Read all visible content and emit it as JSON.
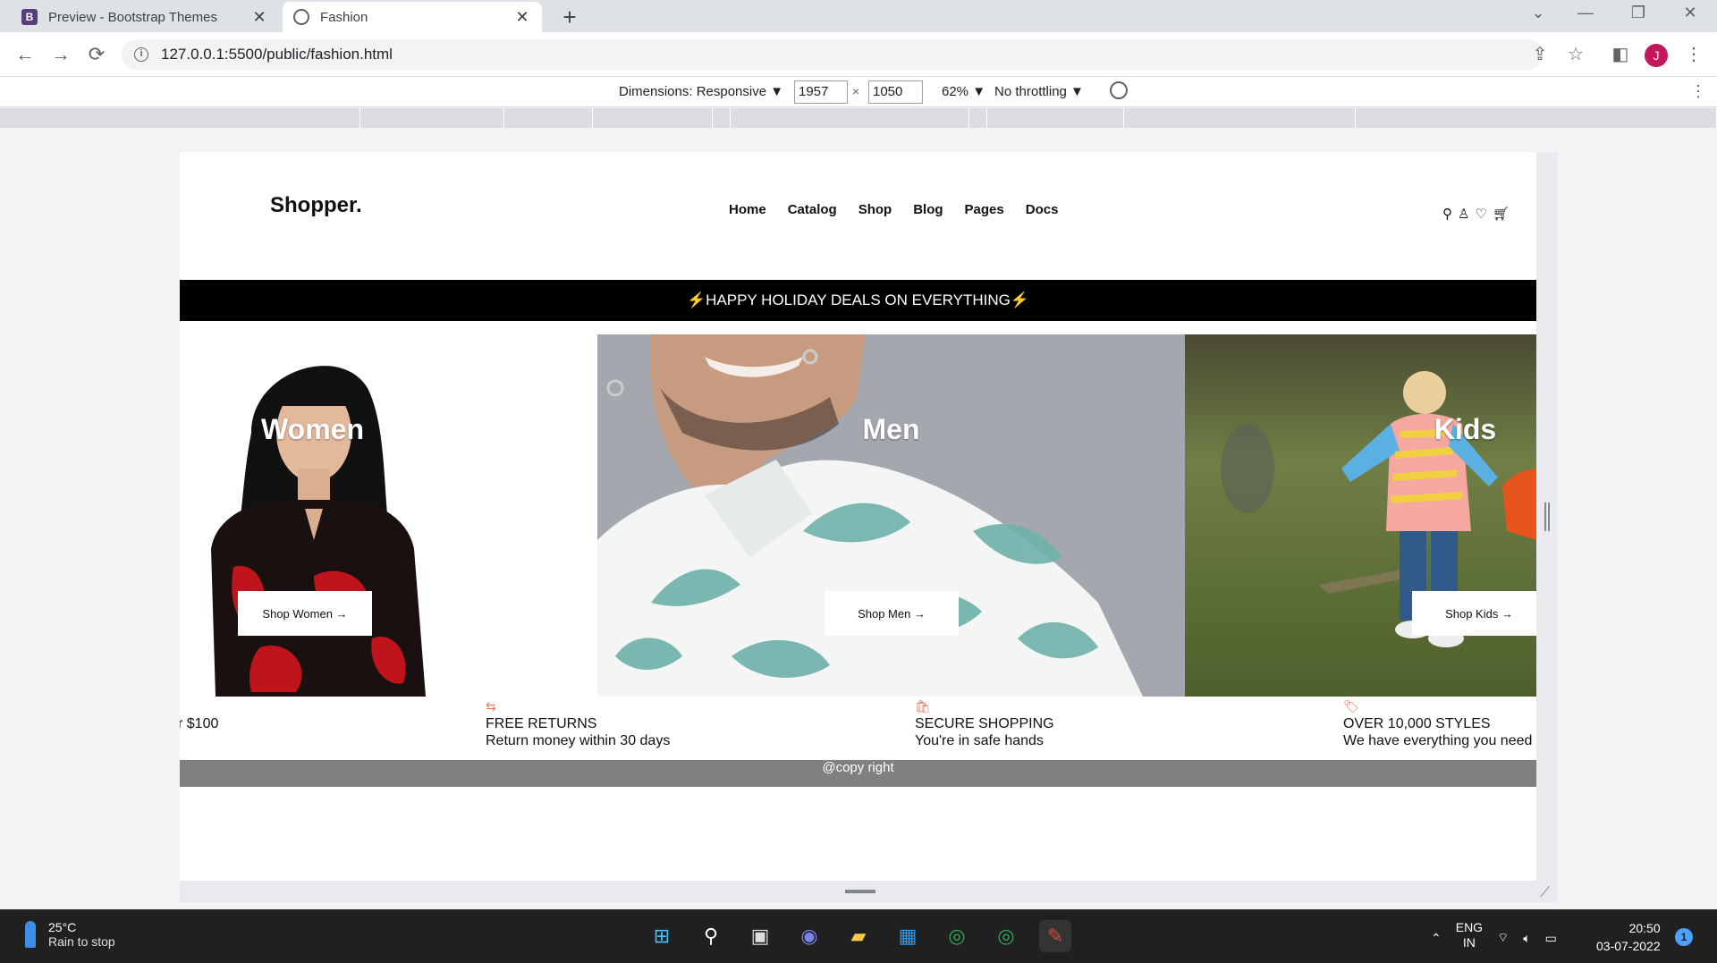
{
  "browser": {
    "tabs": [
      {
        "favicon": "B",
        "title": "Preview - Bootstrap Themes",
        "close": "✕"
      },
      {
        "favicon": "",
        "title": "Fashion",
        "close": "✕"
      }
    ],
    "new_tab": "+",
    "window_controls": {
      "minimize": "—",
      "restore": "❐",
      "close": "✕",
      "tab_search": "⌄"
    },
    "nav": {
      "back": "←",
      "forward": "→",
      "reload": "⟳"
    },
    "url": "127.0.0.1:5500/public/fashion.html",
    "info_icon": "i",
    "toolbar_icons": {
      "share": "⇪",
      "bookmark": "☆",
      "sidepanel": "◧",
      "menu": "⋮"
    },
    "profile_initial": "J"
  },
  "devtools": {
    "dimensions_label": "Dimensions: Responsive ▼",
    "width": "1957",
    "times": "×",
    "height": "1050",
    "zoom": "62% ▼",
    "throttling": "No throttling ▼",
    "more": "⋮"
  },
  "site": {
    "brand": "Shopper.",
    "nav": [
      "Home",
      "Catalog",
      "Shop",
      "Blog",
      "Pages",
      "Docs"
    ],
    "header_icons": {
      "search": "⚲",
      "account": "♙",
      "wishlist": "♡",
      "cart": "🛒︎"
    },
    "promo": {
      "bolt_left": "⚡",
      "text": " HAPPY HOLIDAY DEALS ON EVERYTHING",
      "bolt_right": "⚡"
    },
    "categories": [
      {
        "title": "Women",
        "button": "Shop Women →"
      },
      {
        "title": "Men",
        "button": "Shop Men →"
      },
      {
        "title": "Kids",
        "button": "Shop Kids →"
      }
    ],
    "features": [
      {
        "icon": "",
        "title": "",
        "desc": "r $100"
      },
      {
        "icon": "⇆",
        "title": "FREE RETURNS",
        "desc": "Return money within 30 days"
      },
      {
        "icon": "🛍︎",
        "title": "SECURE SHOPPING",
        "desc": "You're in safe hands"
      },
      {
        "icon": "🏷︎",
        "title": "OVER 10,000 STYLES",
        "desc": "We have everything you need"
      }
    ],
    "footer": "@copy right"
  },
  "taskbar": {
    "weather": {
      "temp": "25°C",
      "desc": "Rain to stop"
    },
    "apps": [
      {
        "icon": "⊞",
        "color": "#4cc2ff"
      },
      {
        "icon": "⚲",
        "color": "#ffffff"
      },
      {
        "icon": "▣",
        "color": "#dddddd"
      },
      {
        "icon": "◉",
        "color": "#7b83eb"
      },
      {
        "icon": "▰",
        "color": "#f9c94c"
      },
      {
        "icon": "▦",
        "color": "#3a96dd"
      },
      {
        "icon": "◎",
        "color": "#34a853"
      },
      {
        "icon": "◎",
        "color": "#34a853"
      },
      {
        "icon": "✎",
        "color": "#e04a3a"
      }
    ],
    "tray": {
      "chevron": "⌃",
      "lang_1": "ENG",
      "lang_2": "IN",
      "wifi": "⌔",
      "volume": "🔈︎",
      "battery": "▭"
    },
    "time": "20:50",
    "date": "03-07-2022",
    "notifications": "1"
  },
  "colors": {
    "promo_bg": "#000000",
    "bolt": "#f5b800",
    "feature_icon": "#e8735a",
    "footer_bg": "#808080",
    "profile": "#c2185b"
  }
}
